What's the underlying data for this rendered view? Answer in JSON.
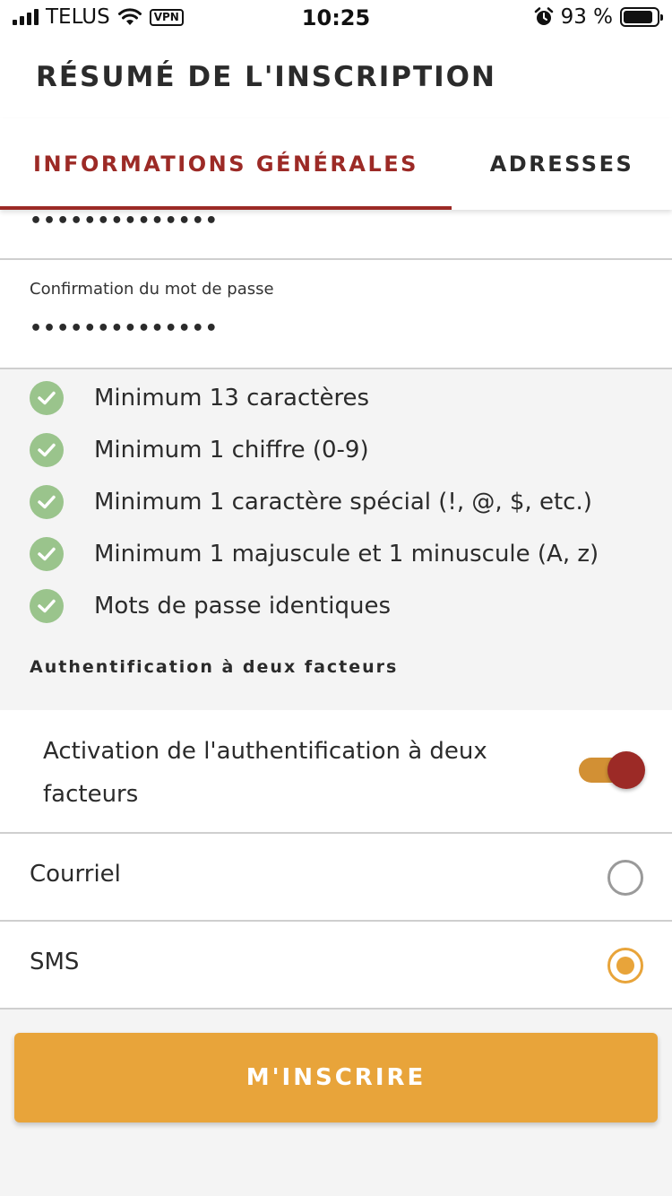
{
  "status_bar": {
    "carrier": "TELUS",
    "vpn": "VPN",
    "time": "10:25",
    "battery_percent": "93 %",
    "icons": [
      "signal-icon",
      "wifi-icon",
      "vpn-icon",
      "alarm-icon",
      "battery-icon"
    ]
  },
  "header": {
    "title": "RÉSUMÉ DE L'INSCRIPTION"
  },
  "tabs": [
    {
      "label": "INFORMATIONS GÉNÉRALES",
      "active": true
    },
    {
      "label": "ADRESSES",
      "active": false
    }
  ],
  "password": {
    "value": "••••••••••••••"
  },
  "confirm_password": {
    "label": "Confirmation du mot de passe",
    "value": "••••••••••••••"
  },
  "requirements": [
    {
      "text": "Minimum 13 caractères",
      "met": true
    },
    {
      "text": "Minimum 1 chiffre (0-9)",
      "met": true
    },
    {
      "text": "Minimum 1 caractère spécial (!, @, $, etc.)",
      "met": true
    },
    {
      "text": "Minimum 1 majuscule et 1 minuscule (A, z)",
      "met": true
    },
    {
      "text": "Mots de passe identiques",
      "met": true
    }
  ],
  "two_factor": {
    "heading": "Authentification à deux facteurs",
    "toggle_label": "Activation de l'authentification à deux facteurs",
    "toggle_on": true,
    "options": [
      {
        "label": "Courriel",
        "selected": false
      },
      {
        "label": "SMS",
        "selected": true
      }
    ]
  },
  "submit": {
    "label": "M'INSCRIRE"
  },
  "colors": {
    "accent_red": "#9c2a26",
    "accent_orange": "#e8a43a",
    "check_green": "#9ac48c",
    "toggle_track": "#d29034"
  }
}
